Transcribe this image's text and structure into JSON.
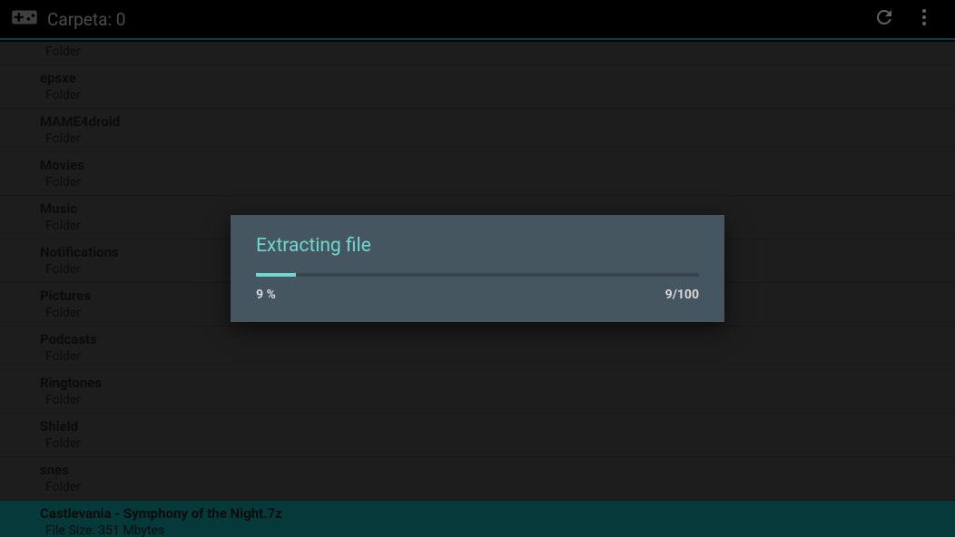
{
  "header": {
    "title": "Carpeta: 0"
  },
  "list": [
    {
      "name": "",
      "sub": "Folder",
      "selected": false,
      "partial": true
    },
    {
      "name": "epsxe",
      "sub": "Folder",
      "selected": false
    },
    {
      "name": "MAME4droid",
      "sub": "Folder",
      "selected": false
    },
    {
      "name": "Movies",
      "sub": "Folder",
      "selected": false
    },
    {
      "name": "Music",
      "sub": "Folder",
      "selected": false
    },
    {
      "name": "Notifications",
      "sub": "Folder",
      "selected": false
    },
    {
      "name": "Pictures",
      "sub": "Folder",
      "selected": false
    },
    {
      "name": "Podcasts",
      "sub": "Folder",
      "selected": false
    },
    {
      "name": "Ringtones",
      "sub": "Folder",
      "selected": false
    },
    {
      "name": "Shield",
      "sub": "Folder",
      "selected": false
    },
    {
      "name": "snes",
      "sub": "Folder",
      "selected": false
    },
    {
      "name": "Castlevania - Symphony of the Night.7z",
      "sub": "File Size: 351 Mbytes",
      "selected": true
    }
  ],
  "dialog": {
    "title": "Extracting file",
    "percent_text": "9 %",
    "count_text": "9/100",
    "percent_value": 9
  }
}
